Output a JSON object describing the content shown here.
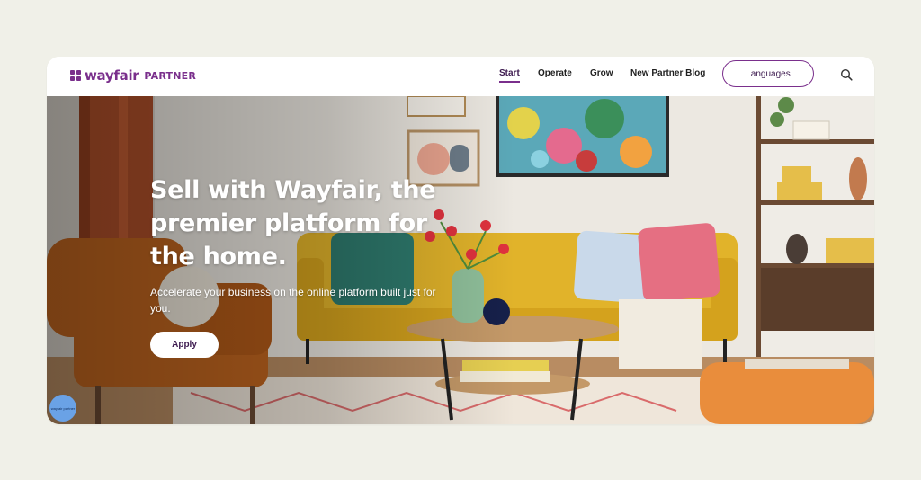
{
  "brand": {
    "logo_text": "wayfair",
    "logo_sub": "PARTNER",
    "accent_color": "#7a2f8c"
  },
  "nav": {
    "items": [
      {
        "label": "Start",
        "active": true
      },
      {
        "label": "Operate",
        "active": false
      },
      {
        "label": "Grow",
        "active": false
      },
      {
        "label": "New Partner Blog",
        "active": false
      }
    ],
    "languages_label": "Languages",
    "search_icon": "search-icon"
  },
  "hero": {
    "title_lines": [
      "Sell with Wayfair, the",
      "premier platform for",
      "the home."
    ],
    "subtitle": "Accelerate your business on the online platform built just for you.",
    "cta_label": "Apply"
  },
  "chat": {
    "label": "wayfair partner"
  }
}
